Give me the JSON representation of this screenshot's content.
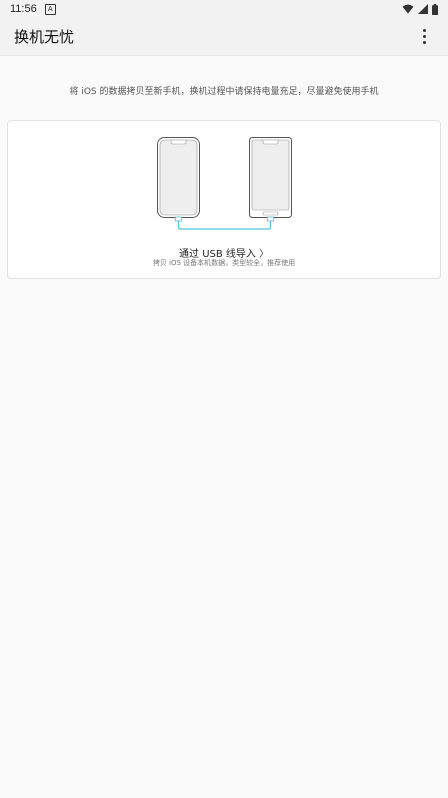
{
  "status_bar": {
    "time": "11:56",
    "notification_glyph": "A"
  },
  "app_bar": {
    "title": "换机无忧"
  },
  "subtitle": "将 iOS 的数据拷贝至新手机，换机过程中请保持电量充足，尽量避免使用手机",
  "usb_card": {
    "title": "通过 USB 线导入",
    "chevron": "〉",
    "description": "拷贝 iOS 设备本机数据，类型较全，推荐使用"
  },
  "colors": {
    "background": "#fafafa",
    "cable": "#4fc3e0",
    "phone_outline": "#555555",
    "phone_screen": "#eeeeee"
  },
  "icons": [
    "notification-a-icon",
    "wifi-icon",
    "signal-icon",
    "battery-icon",
    "more-vert-icon",
    "old-phone-icon",
    "new-phone-icon",
    "usb-cable-icon"
  ]
}
